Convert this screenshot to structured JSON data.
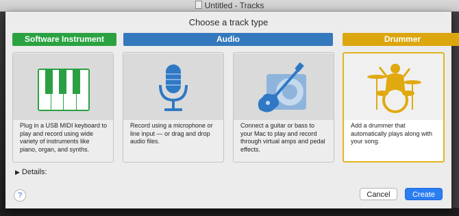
{
  "window": {
    "title": "Untitled - Tracks"
  },
  "dialog": {
    "heading": "Choose a track type",
    "categories": [
      {
        "label": "Software Instrument",
        "color": "#2aa241"
      },
      {
        "label": "Audio",
        "color": "#3479bd"
      },
      {
        "label": "Drummer",
        "color": "#dca60e"
      }
    ],
    "options": [
      {
        "icon": "piano-keyboard-icon",
        "description": "Plug in a USB MIDI keyboard to play and record using wide variety of instruments like piano, organ, and synths."
      },
      {
        "icon": "microphone-icon",
        "description": "Record using a microphone or line input — or drag and drop audio files."
      },
      {
        "icon": "guitar-amp-icon",
        "description": "Connect a guitar or bass to your Mac to play and record through virtual amps and pedal effects."
      },
      {
        "icon": "drummer-icon",
        "description": "Add a drummer that automatically plays along with your song.",
        "selected": true
      }
    ],
    "details_label": "Details:",
    "help_label": "?",
    "cancel_label": "Cancel",
    "create_label": "Create"
  }
}
